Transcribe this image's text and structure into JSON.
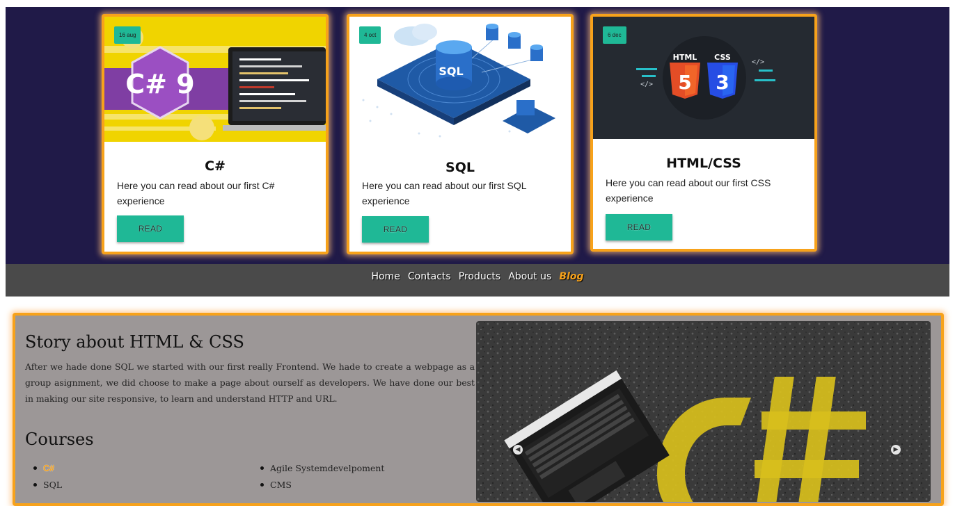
{
  "cards": [
    {
      "date": "16 aug",
      "title": "C#",
      "text": "Here you can read about our first C# experience",
      "button": "READ"
    },
    {
      "date": "4 oct",
      "title": "SQL",
      "text": "Here you can read about our first SQL experience",
      "button": "READ"
    },
    {
      "date": "6 dec",
      "title": "HTML/CSS",
      "text": "Here you can read about our first CSS experience",
      "button": "READ"
    }
  ],
  "nav": {
    "items": [
      "Home",
      "Contacts",
      "Products",
      "About us",
      "Blog"
    ],
    "active": "Blog"
  },
  "story": {
    "title": "Story about HTML & CSS",
    "text": "After we hade done SQL we started with our first really Frontend. We hade to create a webpage as a group asignment, we did choose to make a page about ourself as developers. We have done our best in making our site responsive, to learn and understand HTTP and URL."
  },
  "courses": {
    "title": "Courses",
    "left": [
      "C#",
      "SQL"
    ],
    "right": [
      "Agile Systemdevelpoment",
      "CMS"
    ]
  },
  "colors": {
    "accent": "#f7a21b",
    "button": "#1fb896",
    "banner": "#201a48",
    "nav": "#4a4a4a",
    "panel": "#9c9797"
  },
  "thumb_text": {
    "csharp": "C# 9",
    "sql": "SQL",
    "html": "HTML",
    "css": "CSS"
  },
  "carousel": {
    "prev_icon": "chevron-left-icon",
    "next_icon": "chevron-right-icon"
  }
}
